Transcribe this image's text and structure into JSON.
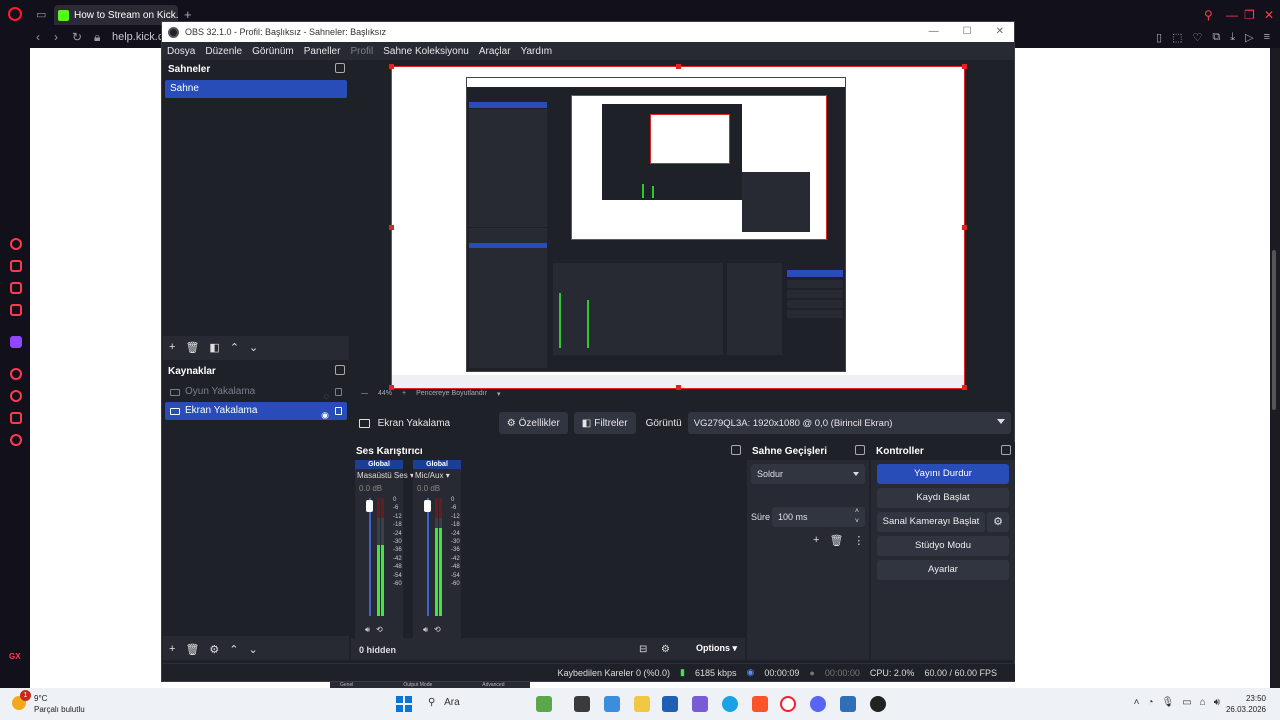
{
  "browser": {
    "tab_title": "How to Stream on Kick.co",
    "url": "help.kick.co"
  },
  "obs": {
    "window_title": "OBS 32.1.0 - Profil: Başlıksız - Sahneler: Başlıksız",
    "menu": [
      "Dosya",
      "Düzenle",
      "Görünüm",
      "Paneller",
      "Profil",
      "Sahne Koleksiyonu",
      "Araçlar",
      "Yardım"
    ],
    "scenes": {
      "title": "Sahneler",
      "items": [
        "Sahne"
      ]
    },
    "sources": {
      "title": "Kaynaklar",
      "items": [
        {
          "label": "Oyun Yakalama",
          "state": "hidden"
        },
        {
          "label": "Ekran Yakalama",
          "state": "selected"
        }
      ]
    },
    "preview": {
      "zoom": "44%",
      "fit_label": "Pencereye Boyutlandır"
    },
    "source_toolbar": {
      "source_name": "Ekran Yakalama",
      "properties": "Özellikler",
      "filters": "Filtreler",
      "display_label": "Görüntü",
      "display_value": "VG279QL3A: 1920x1080 @ 0,0 (Birincil Ekran)"
    },
    "mixer": {
      "title": "Ses Karıştırıcı",
      "channels": [
        {
          "scope": "Global",
          "name": "Masaüstü Ses",
          "db": "0.0 dB",
          "level": 0.6
        },
        {
          "scope": "Global",
          "name": "Mic/Aux",
          "db": "0.0 dB",
          "level": 0.75
        }
      ],
      "scale": [
        "0",
        "-6",
        "-12",
        "-18",
        "-24",
        "-30",
        "-36",
        "-42",
        "-48",
        "-54",
        "-60"
      ],
      "hidden": "0 hidden",
      "options": "Options"
    },
    "transitions": {
      "title": "Sahne Geçişleri",
      "selected": "Soldur",
      "duration_label": "Süre",
      "duration": "100 ms"
    },
    "controls": {
      "title": "Kontroller",
      "buttons": [
        "Yayını Durdur",
        "Kaydı Başlat",
        "Sanal Kamerayı Başlat",
        "Stüdyo Modu",
        "Ayarlar"
      ]
    },
    "status": {
      "dropped": "Kaybedilen Kareler 0 (%0.0)",
      "bitrate": "6185 kbps",
      "stream_time": "00:00:09",
      "rec_time": "00:00:00",
      "cpu": "CPU: 2.0%",
      "fps": "60.00 / 60.00 FPS"
    },
    "hidden_tabs": [
      "Genel",
      "Output Mode",
      "Advanced"
    ]
  },
  "taskbar": {
    "temp": "9°C",
    "weather": "Parçalı bulutlu",
    "badge": "1",
    "search": "Ara",
    "time": "23:50",
    "date": "26.03.2026"
  },
  "colors": {
    "accent": "#284cb8",
    "obs_bg": "#1f2129",
    "dock_bg": "#272a33",
    "red_border": "#e02424",
    "meter_green": "#41e641"
  }
}
